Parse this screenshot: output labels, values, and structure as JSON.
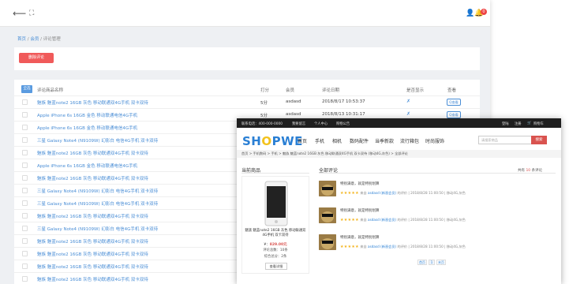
{
  "admin": {
    "breadcrumb": [
      "首页",
      "会员",
      "评论管理"
    ],
    "delete_button": "删除评论",
    "header": {
      "all_button": "全选",
      "product": "评论商品名称",
      "score": "打分",
      "member": "会员",
      "date": "评论日期",
      "shown": "是否显示",
      "view": "查看"
    },
    "rows": [
      {
        "name": "魅族 魅蓝note2 16GB 灰色 移动联通双4G手机 双卡双待",
        "score": "5分",
        "member": "asdasd",
        "date": "2018/8/17 10:53:37",
        "shown": "✗",
        "view": "Q查看"
      },
      {
        "name": "Apple iPhone 6s 16GB 金色 移动联通电信4G手机",
        "score": "5分",
        "member": "asdasd",
        "date": "2018/8/13 10:31:17",
        "shown": "✗",
        "view": "Q查看"
      },
      {
        "name": "Apple iPhone 6s 16GB 金色 移动联通电信4G手机",
        "score": "",
        "member": "",
        "date": "",
        "shown": "",
        "view": ""
      },
      {
        "name": "三星 Galaxy Note4 (N9109W) 幻影白 电信4G手机 双卡双待",
        "score": "",
        "member": "",
        "date": "",
        "shown": "",
        "view": ""
      },
      {
        "name": "魅族 魅蓝note2 16GB 灰色 移动联通双4G手机 双卡双待",
        "score": "",
        "member": "",
        "date": "",
        "shown": "",
        "view": ""
      },
      {
        "name": "Apple iPhone 6s 16GB 金色 移动联通电信4G手机",
        "score": "",
        "member": "",
        "date": "",
        "shown": "",
        "view": ""
      },
      {
        "name": "魅族 魅蓝note2 16GB 灰色 移动联通双4G手机 双卡双待",
        "score": "",
        "member": "",
        "date": "",
        "shown": "",
        "view": ""
      },
      {
        "name": "三星 Galaxy Note4 (N9109W) 幻影白 电信4G手机 双卡双待",
        "score": "",
        "member": "",
        "date": "",
        "shown": "",
        "view": ""
      },
      {
        "name": "三星 Galaxy Note4 (N9109W) 幻影白 电信4G手机 双卡双待",
        "score": "",
        "member": "",
        "date": "",
        "shown": "",
        "view": ""
      },
      {
        "name": "魅族 魅蓝note2 16GB 灰色 移动联通双4G手机 双卡双待",
        "score": "",
        "member": "",
        "date": "",
        "shown": "",
        "view": ""
      },
      {
        "name": "三星 Galaxy Note4 (N9109W) 幻影白 电信4G手机 双卡双待",
        "score": "",
        "member": "",
        "date": "",
        "shown": "",
        "view": ""
      },
      {
        "name": "魅族 魅蓝note2 16GB 灰色 移动联通双4G手机 双卡双待",
        "score": "",
        "member": "",
        "date": "",
        "shown": "",
        "view": ""
      },
      {
        "name": "魅族 魅蓝note2 16GB 灰色 移动联通双4G手机 双卡双待",
        "score": "",
        "member": "",
        "date": "",
        "shown": "",
        "view": ""
      },
      {
        "name": "魅族 魅蓝note2 16GB 灰色 移动联通双4G手机 双卡双待",
        "score": "",
        "member": "",
        "date": "",
        "shown": "",
        "view": ""
      },
      {
        "name": "魅族 魅蓝note2 16GB 灰色 移动联通双4G手机 双卡双待",
        "score": "",
        "member": "",
        "date": "",
        "shown": "",
        "view": ""
      }
    ]
  },
  "shop": {
    "topbar": {
      "hotline": "联系电话：400-000-0000",
      "links": [
        "我要留言",
        "个人中心",
        "购物公告"
      ],
      "login": "登陆",
      "register": "注册",
      "cart": "购物车"
    },
    "logo": "SHOPWE",
    "nav": [
      "首页",
      "手机",
      "相机",
      "数码配件",
      "当季新款",
      "流行箱包",
      "时尚服饰"
    ],
    "search_placeholder": "请搜索商品",
    "search_button": "搜索",
    "breadcrumb": "首页 > 手机数码 > 手机 > 魅族 魅蓝note2 16GB 灰色 移动联通双4G手机 双卡双待 (移动4G,灰色) > 全部评论",
    "current_product_title": "当前商品",
    "all_reviews_title": "全部评论",
    "review_count_prefix": "共有",
    "review_count": "10",
    "review_count_suffix": "条评论",
    "product": {
      "name": "魅族 魅蓝note2 16GB 灰色 移动联通双4G手机 双卡双待",
      "price_label": "¥：",
      "price": "829.00元",
      "rating_count": "评论总数：10条",
      "score": "综合总分：2条",
      "detail_button": "查看详细"
    },
    "reviews": [
      {
        "text": "特别满意，就是特别划算",
        "stars": "★★★★★",
        "from": "来自",
        "user": "asdasd (新晋会员)",
        "suffix": "的评价 | 2018/8/28 11:00:50 | 移动4G,灰色"
      },
      {
        "text": "特别满意，就是特别划算",
        "stars": "★★★★★",
        "from": "来自",
        "user": "asdasd (新晋会员)",
        "suffix": "的评价 | 2018/8/28 11:00:50 | 移动4G,灰色"
      },
      {
        "text": "特别满意，就是特别划算",
        "stars": "★★★★★",
        "from": "来自",
        "user": "asdasd (新晋会员)",
        "suffix": "的评价 | 2018/8/28 11:00:50 | 移动4G,灰色"
      }
    ],
    "pager": [
      "首页",
      "1",
      "末页"
    ]
  }
}
